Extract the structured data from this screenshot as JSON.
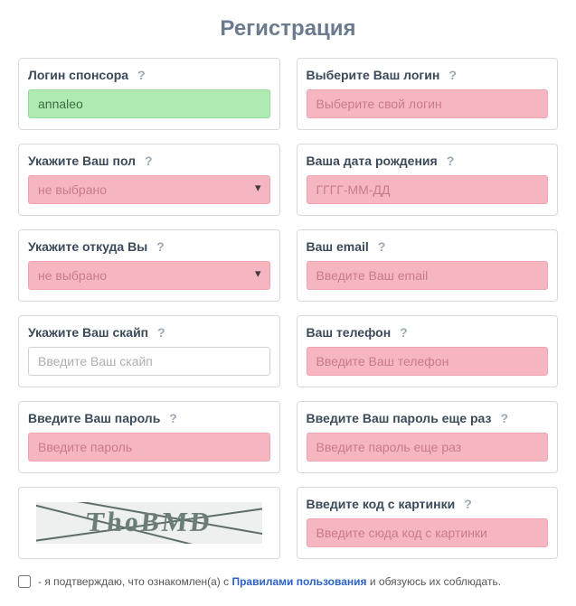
{
  "title": "Регистрация",
  "fields": {
    "sponsor": {
      "label": "Логин спонсора",
      "value": "annaleo"
    },
    "login": {
      "label": "Выберите Ваш логин",
      "placeholder": "Выберите свой логин"
    },
    "gender": {
      "label": "Укажите Ваш пол",
      "selected": "не выбрано"
    },
    "birth": {
      "label": "Ваша дата рождения",
      "placeholder": "ГГГГ-ММ-ДД"
    },
    "from": {
      "label": "Укажите откуда Вы",
      "selected": "не выбрано"
    },
    "email": {
      "label": "Ваш email",
      "placeholder": "Введите Ваш email"
    },
    "skype": {
      "label": "Укажите Ваш скайп",
      "placeholder": "Введите Ваш скайп"
    },
    "phone": {
      "label": "Ваш телефон",
      "placeholder": "Введите Ваш телефон"
    },
    "pass": {
      "label": "Введите Ваш пароль",
      "placeholder": "Введите пароль"
    },
    "pass2": {
      "label": "Введите Ваш пароль еще раз",
      "placeholder": "Введите пароль еще раз"
    },
    "captcha": {
      "label": "Введите код с картинки",
      "placeholder": "Введите сюда код с картинки",
      "image_text": "ThoBMD"
    }
  },
  "help_glyph": "?",
  "agree": {
    "prefix": "- я подтверждаю, что ознакомлен(а) с",
    "link_text": "Правилами пользования",
    "suffix": "и обязуюсь их соблюдать."
  }
}
